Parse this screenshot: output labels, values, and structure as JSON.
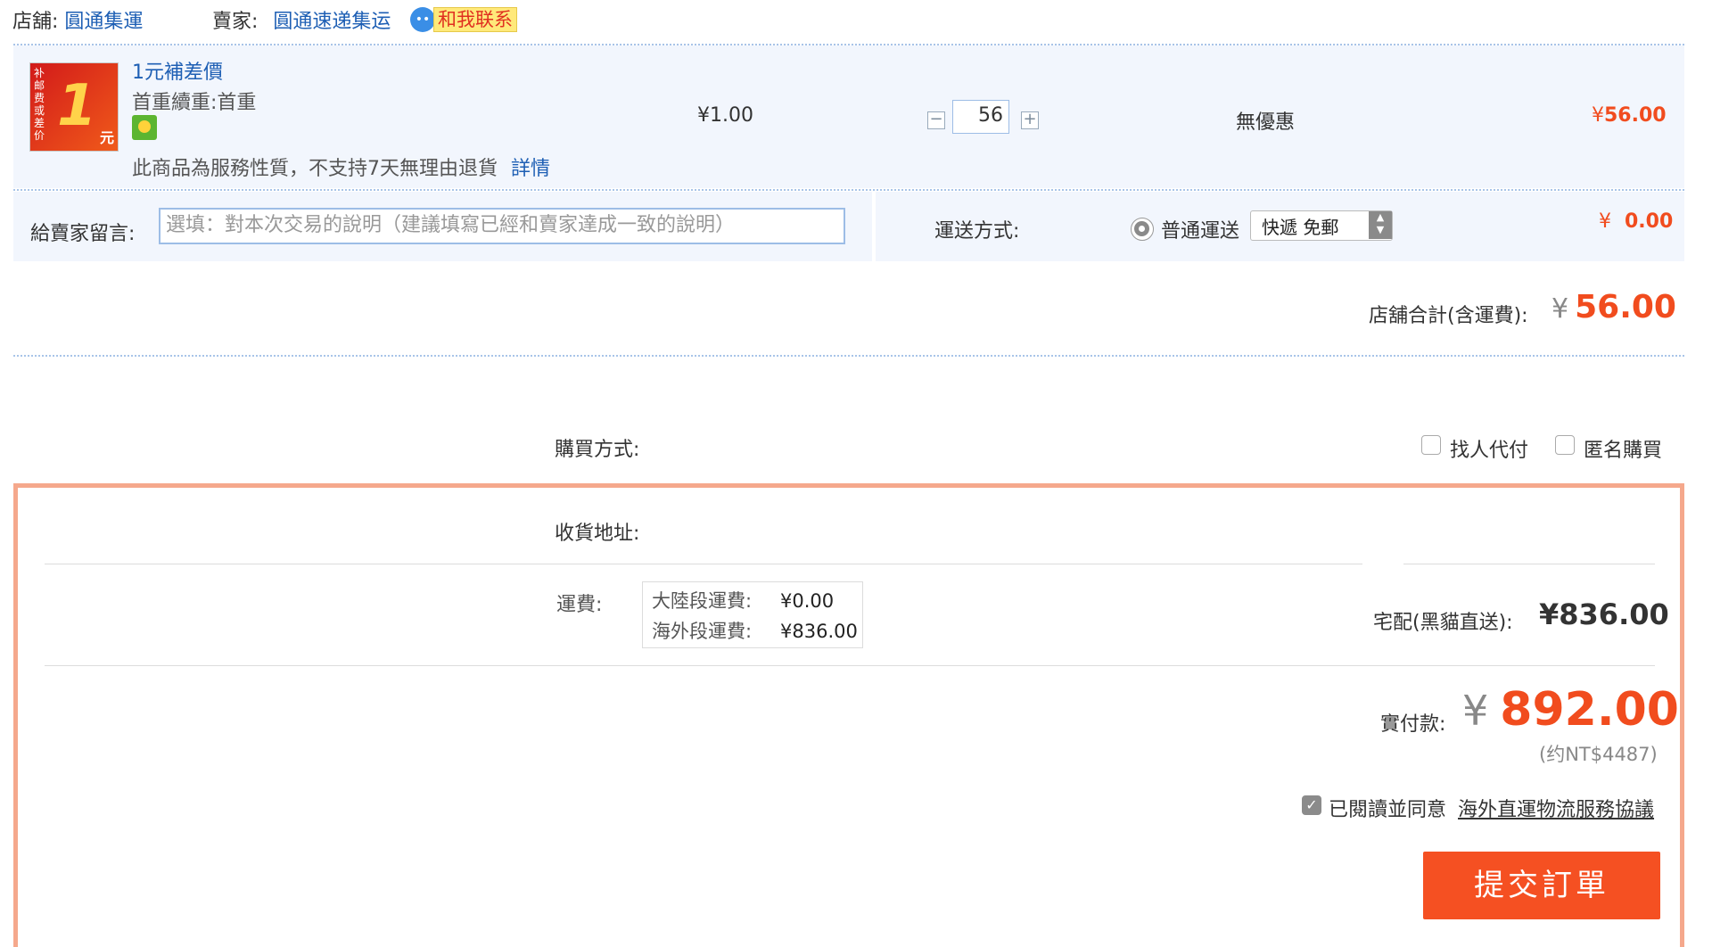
{
  "shop": {
    "shop_label": "店舖:",
    "shop_name": "圓通集運",
    "seller_label": "賣家:",
    "seller_name": "圓通速递集运",
    "contact_label": "和我联系"
  },
  "item": {
    "title": "1元補差價",
    "attribute": "首重續重:首重",
    "notice": "此商品為服務性質，不支持7天無理由退貨",
    "details_link": "詳情",
    "unit_price": "¥1.00",
    "quantity": "56",
    "discount": "無優惠",
    "subtotal_symbol": "¥",
    "subtotal_value": "56.00",
    "thumbnail_text": "1元"
  },
  "message": {
    "label": "給賣家留言:",
    "placeholder": "選填：對本次交易的說明（建議填寫已經和賣家達成一致的說明）"
  },
  "shipping": {
    "label": "運送方式:",
    "option_label": "普通運送",
    "select_value": "快遞 免郵",
    "fee_symbol": "¥",
    "fee_value": "0.00"
  },
  "shop_total": {
    "label": "店舖合計(含運費):",
    "symbol": "¥",
    "value": "56.00"
  },
  "purchase": {
    "label": "購買方式:",
    "option_proxy_pay": "找人代付",
    "option_anonymous": "匿名購買"
  },
  "address": {
    "label": "收貨地址:"
  },
  "freight": {
    "label": "運費:",
    "mainland_label": "大陸段運費:",
    "mainland_value": "¥0.00",
    "overseas_label": "海外段運費:",
    "overseas_value": "¥836.00",
    "delivery_label": "宅配(黑貓直送):",
    "delivery_value": "¥836.00"
  },
  "payment": {
    "label": "實付款:",
    "symbol": "¥",
    "value": "892.00",
    "approx": "(约NT$4487)"
  },
  "agreement": {
    "text": "已閱讀並同意",
    "link": "海外直運物流服務協議"
  },
  "submit_label": "提交訂單",
  "colors": {
    "accent": "#f14c1e",
    "link": "#1e5fb4",
    "border_highlight": "#f5a88c"
  }
}
